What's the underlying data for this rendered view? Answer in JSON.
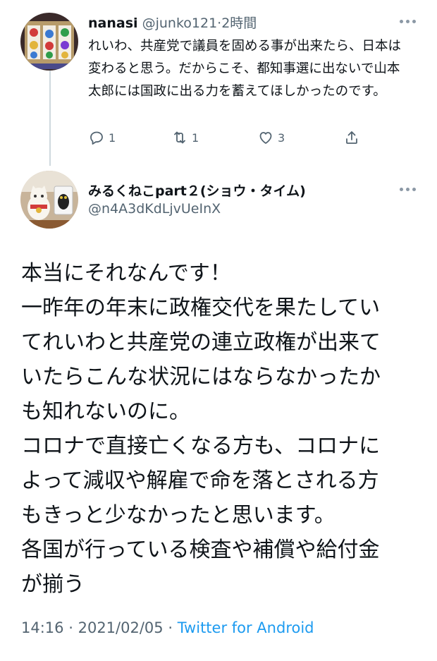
{
  "reply_tweet": {
    "display_name": "nanasi",
    "handle": "@junko121",
    "separator": "·",
    "time": "2時間",
    "text": "れいわ、共産党で議員を固める事が出来たら、日本は変わると思う。だからこそ、都知事選に出ないで山本太郎には国政に出る力を蓄えてほしかったのです。",
    "reply_count": "1",
    "retweet_count": "1",
    "like_count": "3"
  },
  "main_tweet": {
    "display_name": "みるくねこpart２(ショウ・タイム)",
    "handle": "@n4A3dKdLjvUeInX",
    "text_lines": [
      "本当にそれなんです！",
      "一昨年の年末に政権交代を果たしてい",
      "てれいわと共産党の連立政権が出来て",
      "いたらこんな状況にはならなかったか",
      "も知れないのに。",
      "コロナで直接亡くなる方も、コロナに",
      "よって減収や解雇で命を落とされる方",
      "もきっと少なかったと思います。",
      "各国が行っている検査や補償や給付金",
      "が揃う"
    ],
    "time": "14:16",
    "separator": "·",
    "date": "2021/02/05",
    "separator2": "·",
    "source": "Twitter for Android"
  },
  "colors": {
    "text": "#0f1419",
    "secondary": "#536471",
    "link": "#1d9bf0",
    "thread_line": "#cfd9de"
  },
  "icons": [
    "more-horizontal-icon",
    "reply-icon",
    "retweet-icon",
    "like-icon",
    "share-icon"
  ]
}
